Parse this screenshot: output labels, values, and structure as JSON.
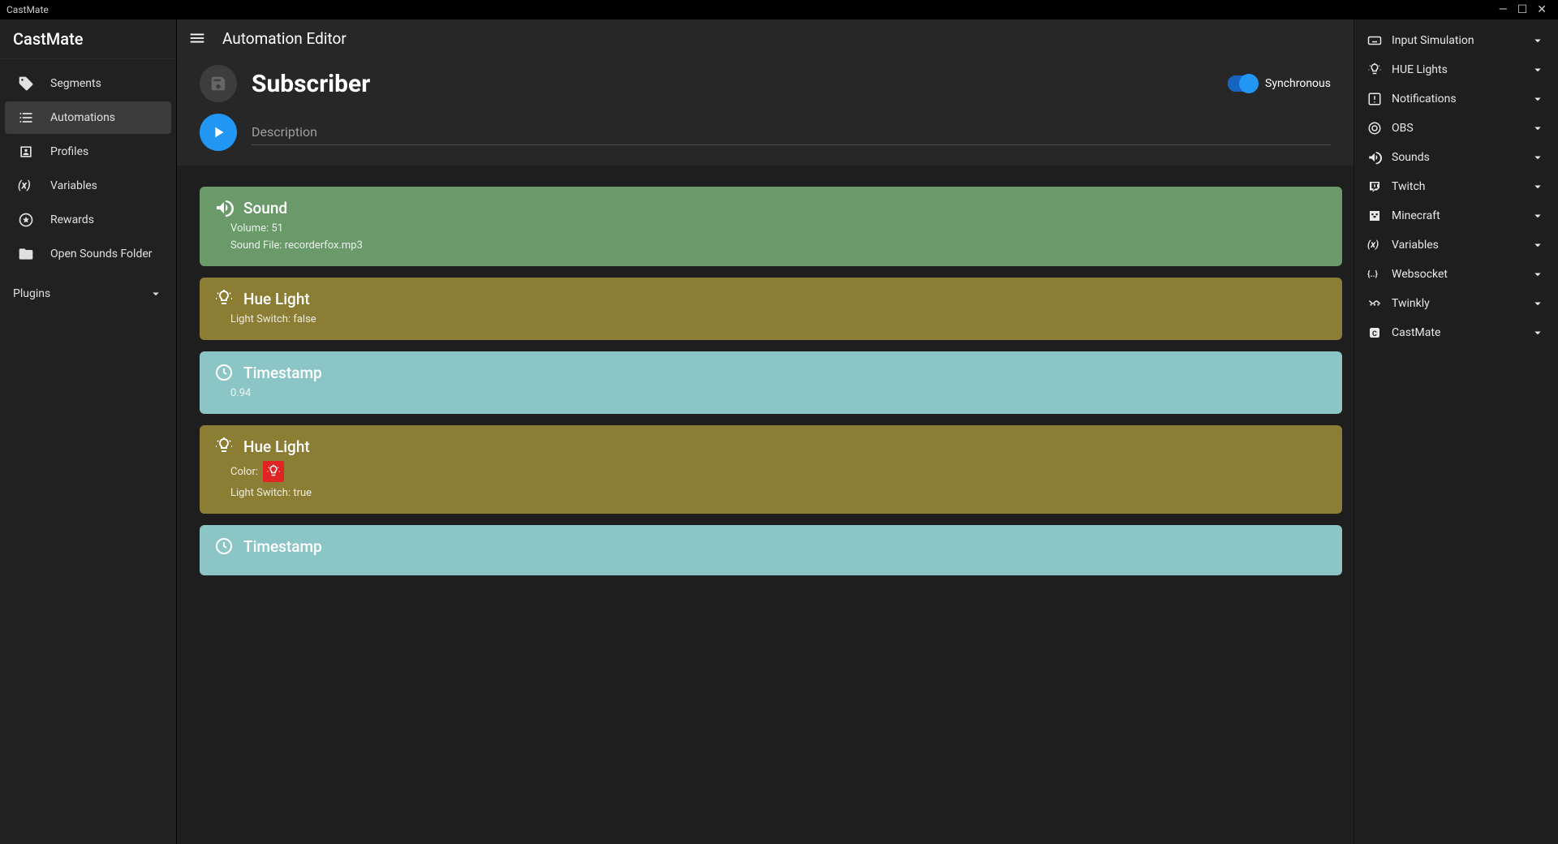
{
  "window": {
    "title": "CastMate"
  },
  "brand": "CastMate",
  "topbar": {
    "title": "Automation Editor"
  },
  "sidebar": {
    "items": [
      {
        "label": "Segments",
        "icon": "tag"
      },
      {
        "label": "Automations",
        "icon": "automations",
        "active": true
      },
      {
        "label": "Profiles",
        "icon": "profile"
      },
      {
        "label": "Variables",
        "icon": "variables"
      },
      {
        "label": "Rewards",
        "icon": "reward"
      },
      {
        "label": "Open Sounds Folder",
        "icon": "folder"
      }
    ],
    "plugins_label": "Plugins"
  },
  "editor": {
    "name": "Subscriber",
    "description_placeholder": "Description",
    "synchronous_label": "Synchronous",
    "synchronous": true
  },
  "actions": [
    {
      "type": "sound",
      "title": "Sound",
      "color": "#6a9a6a",
      "lines": [
        "Volume: 51",
        "Sound File: recorderfox.mp3"
      ]
    },
    {
      "type": "hue",
      "title": "Hue Light",
      "color": "#8b7d34",
      "lines": [
        "Light Switch: false"
      ]
    },
    {
      "type": "timestamp",
      "title": "Timestamp",
      "color": "#8bc5c5",
      "lines": [
        "0.94"
      ]
    },
    {
      "type": "hue",
      "title": "Hue Light",
      "color": "#8b7d34",
      "color_label": "Color:",
      "swatch": "#e02424",
      "lines": [
        "Light Switch: true"
      ]
    },
    {
      "type": "timestamp",
      "title": "Timestamp",
      "color": "#8bc5c5",
      "lines": []
    }
  ],
  "categories": [
    {
      "label": "Input Simulation",
      "icon": "keyboard"
    },
    {
      "label": "HUE Lights",
      "icon": "bulb"
    },
    {
      "label": "Notifications",
      "icon": "alert"
    },
    {
      "label": "OBS",
      "icon": "obs"
    },
    {
      "label": "Sounds",
      "icon": "sound"
    },
    {
      "label": "Twitch",
      "icon": "twitch"
    },
    {
      "label": "Minecraft",
      "icon": "minecraft"
    },
    {
      "label": "Variables",
      "icon": "variables"
    },
    {
      "label": "Websocket",
      "icon": "websocket"
    },
    {
      "label": "Twinkly",
      "icon": "twinkly"
    },
    {
      "label": "CastMate",
      "icon": "castmate"
    }
  ]
}
